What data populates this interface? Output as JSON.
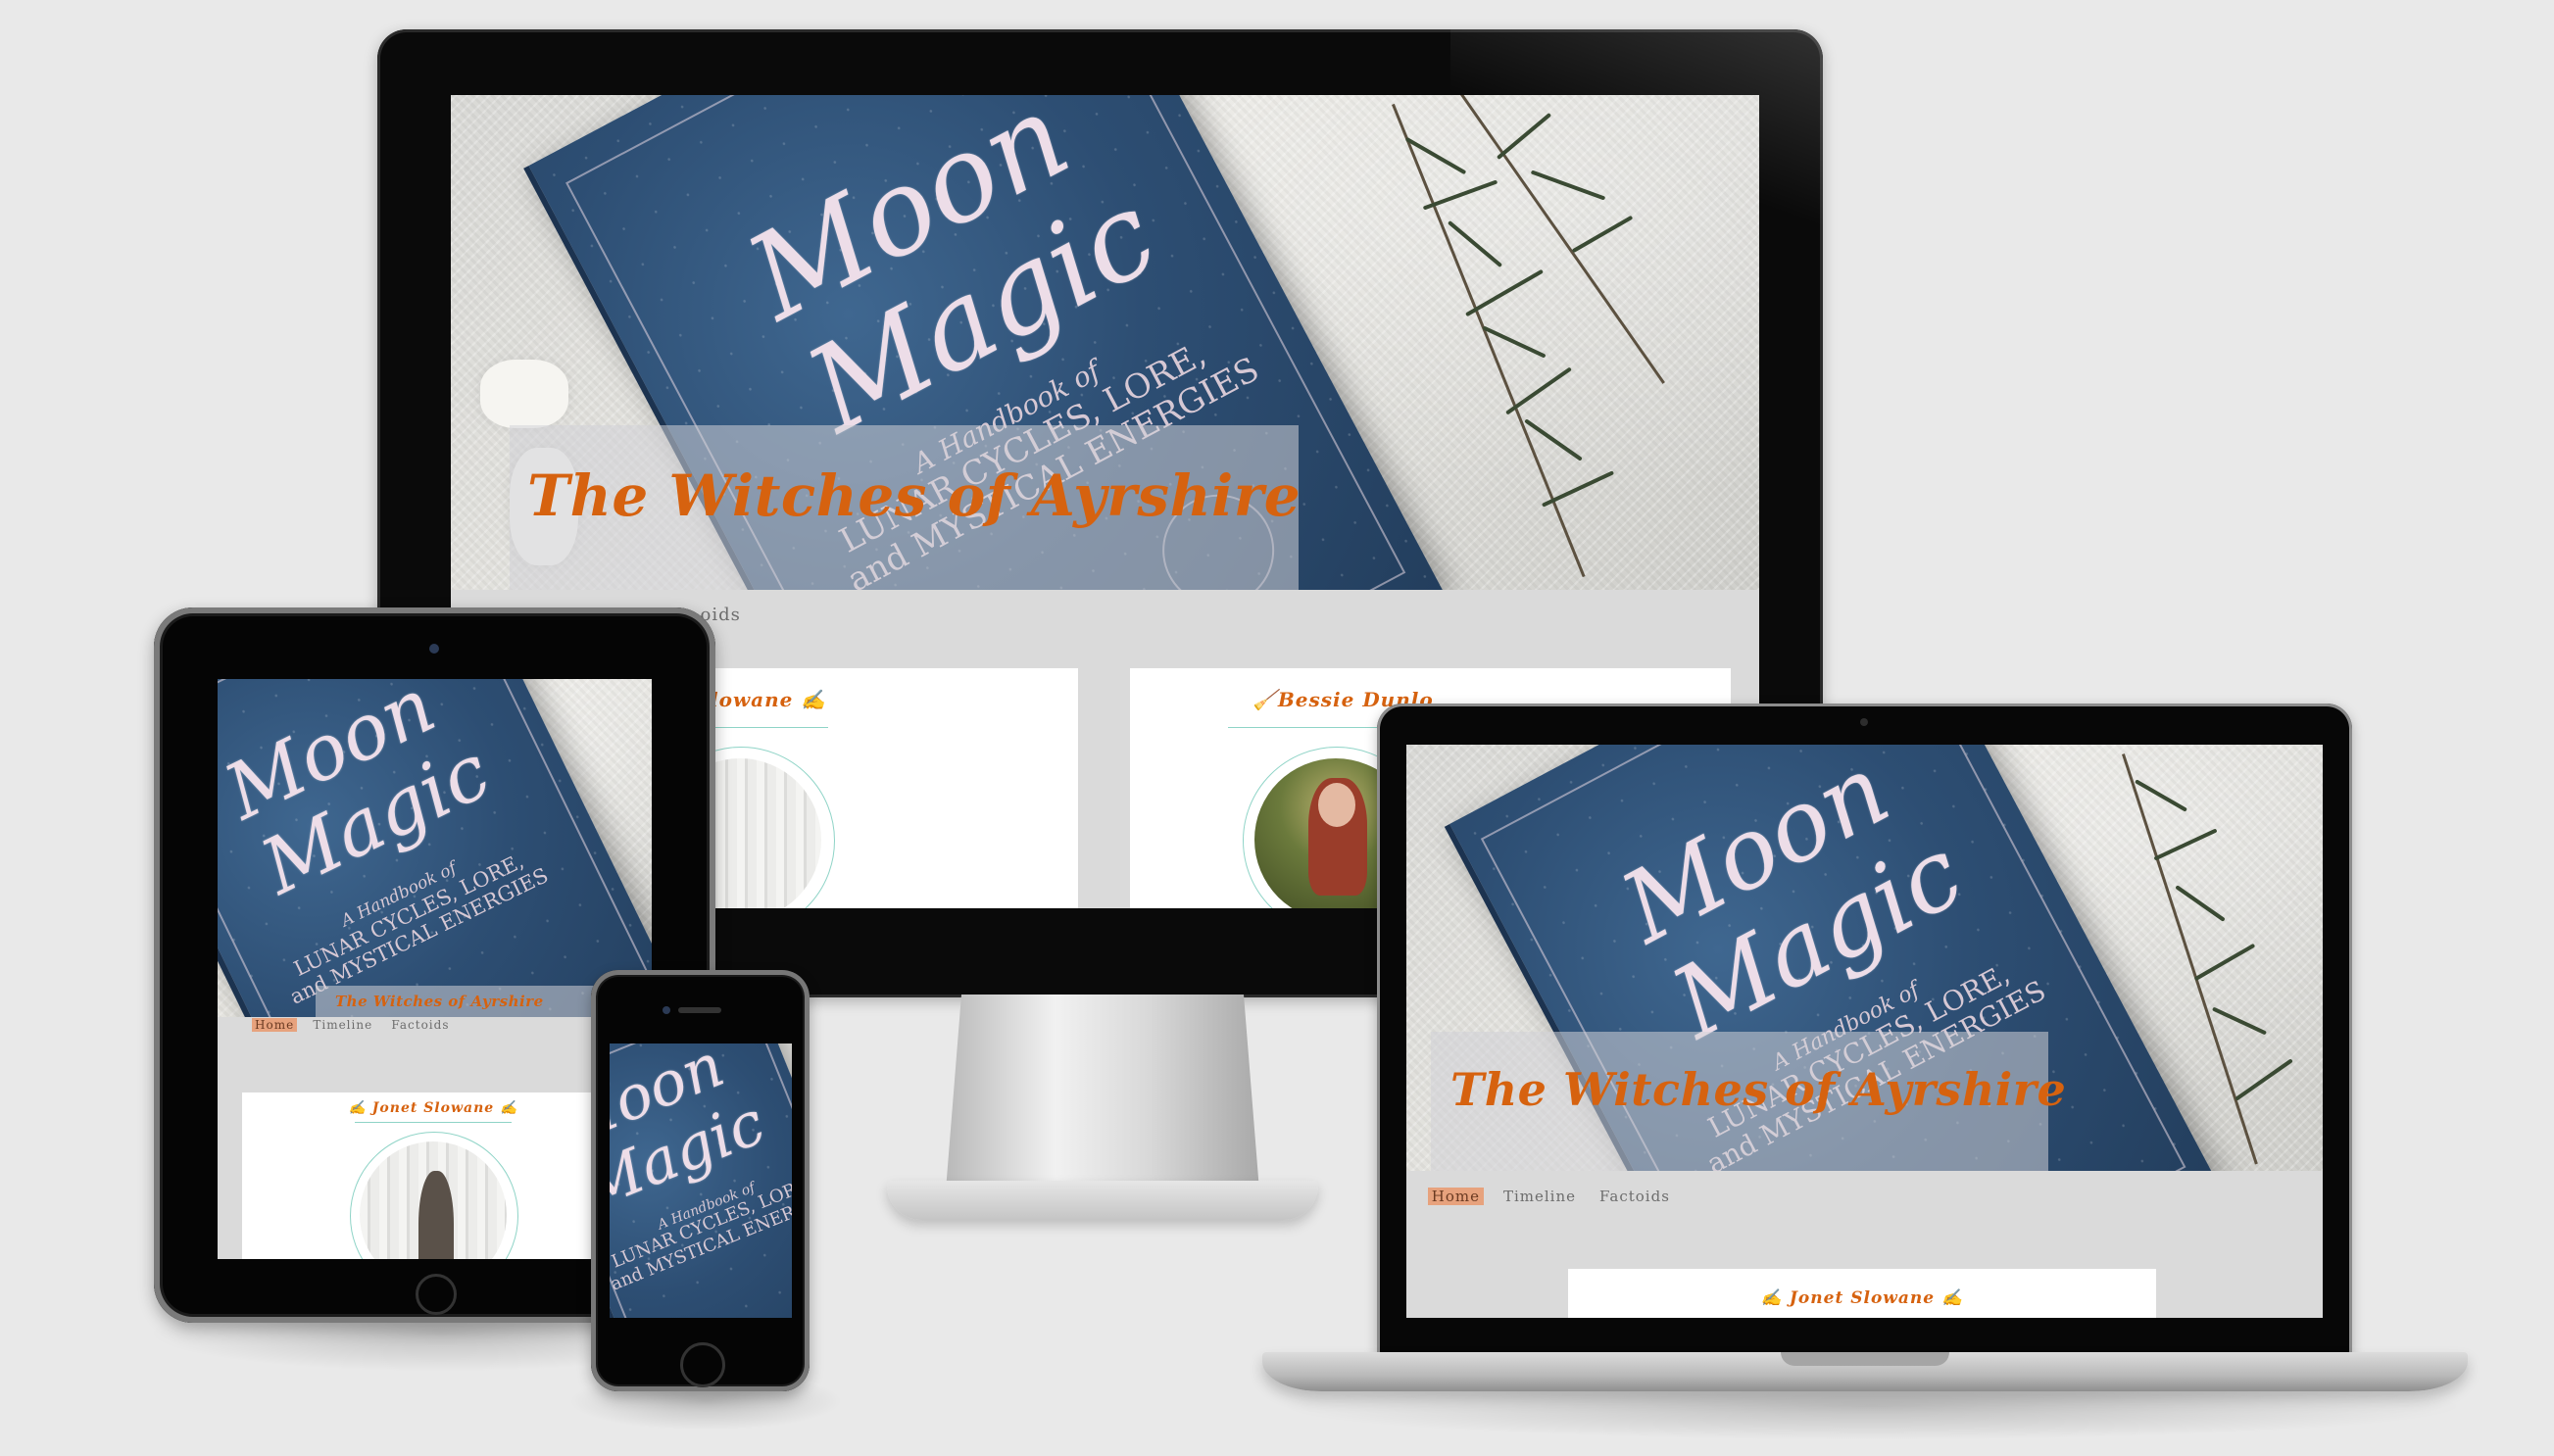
{
  "site": {
    "title": "The Witches of Ayrshire",
    "nav": [
      "Home",
      "Timeline",
      "Factoids"
    ],
    "nav_active": "Home",
    "nav_partial": "oids",
    "cards": [
      {
        "name": "✍ Jonet Slowane ✍"
      },
      {
        "name": "🧹Bessie Dunlop🧹"
      }
    ],
    "card_partial_name": "lowane ✍",
    "card_partial_name_right": "🧹Bessie Dunlo"
  },
  "book": {
    "title_line1": "Moon",
    "title_line2": "Magic",
    "subtitle_line1": "A Handbook of",
    "subtitle_line2": "LUNAR CYCLES, LORE,",
    "subtitle_line3": "and MYSTICAL ENERGIES"
  },
  "colors": {
    "accent": "#d6620f",
    "nav_highlight": "#e7a27d",
    "ring": "#8fd4c7",
    "page_bg": "#dadada",
    "backdrop": "#e9e9e9"
  },
  "icons": [
    "quill-icon",
    "broom-icon"
  ]
}
